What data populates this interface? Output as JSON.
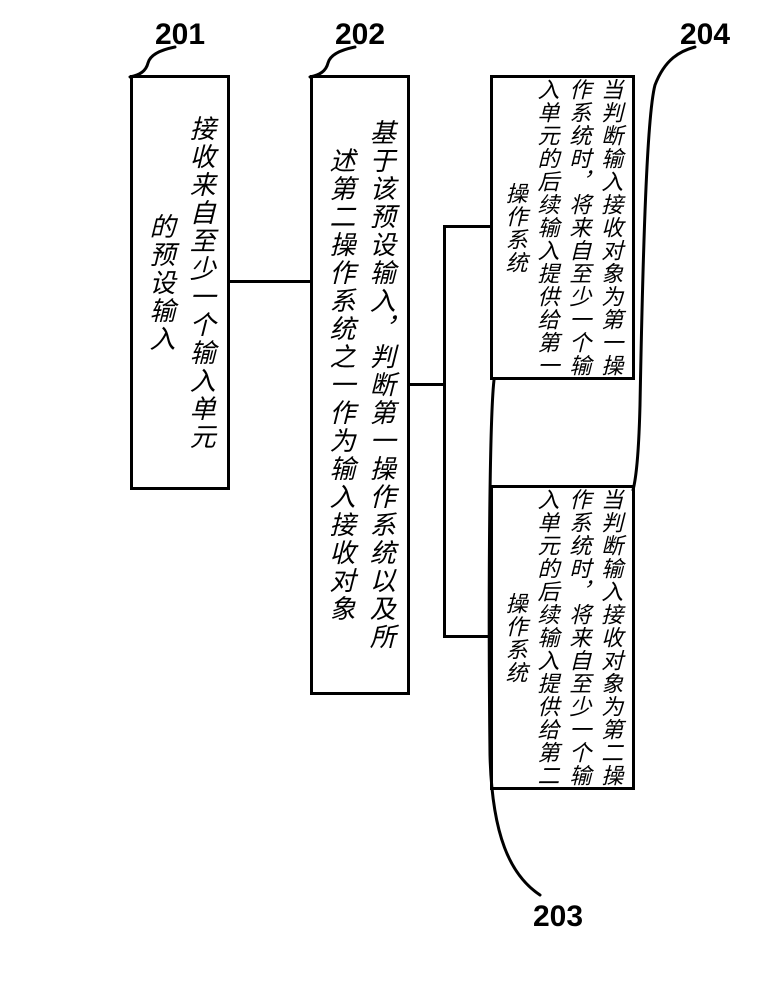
{
  "labels": {
    "n201": "201",
    "n202": "202",
    "n203": "203",
    "n204": "204"
  },
  "boxes": {
    "b201": "接收来自至少一个输入单元\n的预设输入",
    "b202": "基于该预设输入，判断第一操作系统以及所\n述第二操作系统之一作为输入接收对象",
    "b203": "当判断输入接收对象为第一操\n作系统时，将来自至少一个输\n入单元的后续输入提供给第一\n操作系统",
    "b204": "当判断输入接收对象为第二操\n作系统时，将来自至少一个输\n入单元的后续输入提供给第二\n操作系统"
  }
}
